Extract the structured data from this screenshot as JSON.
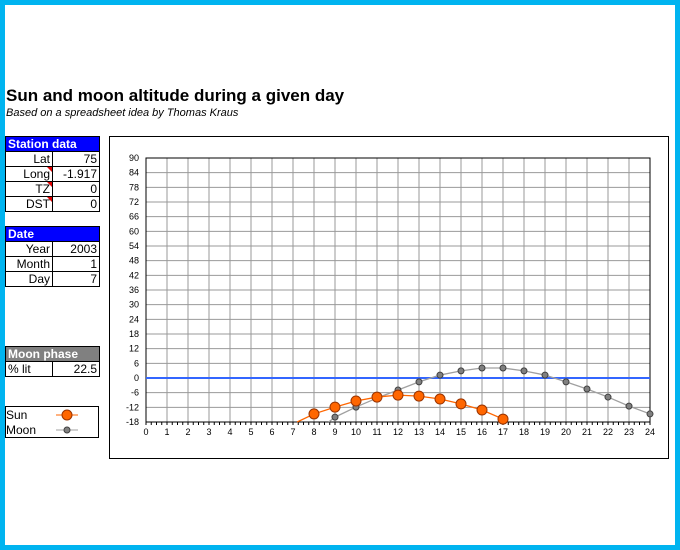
{
  "title": "Sun and moon altitude during a given day",
  "subtitle": "Based on a spreadsheet idea by Thomas Kraus",
  "station": {
    "header": "Station data",
    "rows": [
      {
        "label": "Lat",
        "value": "75"
      },
      {
        "label": "Long",
        "value": "-1.917"
      },
      {
        "label": "TZ",
        "value": "0"
      },
      {
        "label": "DST",
        "value": "0"
      }
    ]
  },
  "date": {
    "header": "Date",
    "rows": [
      {
        "label": "Year",
        "value": "2003"
      },
      {
        "label": "Month",
        "value": "1"
      },
      {
        "label": "Day",
        "value": "7"
      }
    ]
  },
  "moon_phase": {
    "header": "Moon phase",
    "label": "% lit",
    "value": "22.5"
  },
  "legend": {
    "sun": "Sun",
    "moon": "Moon"
  },
  "colors": {
    "sun": "#ff6600",
    "moon": "#808080",
    "zero_line": "#3366ff"
  },
  "chart_data": {
    "type": "line",
    "xlim": [
      0,
      24
    ],
    "ylim": [
      -18,
      90
    ],
    "x_ticks": [
      0,
      1,
      2,
      3,
      4,
      5,
      6,
      7,
      8,
      9,
      10,
      11,
      12,
      13,
      14,
      15,
      16,
      17,
      18,
      19,
      20,
      21,
      22,
      23,
      24
    ],
    "y_ticks": [
      -18,
      -12,
      -6,
      0,
      6,
      12,
      18,
      24,
      30,
      36,
      42,
      48,
      54,
      60,
      66,
      72,
      78,
      84,
      90
    ],
    "grid": true,
    "series": [
      {
        "name": "Sun",
        "x": [
          7.2,
          8,
          9,
          10,
          11,
          12,
          13,
          14,
          15,
          16,
          17,
          17.2
        ],
        "y": [
          -18,
          -14.7,
          -11.9,
          -9.4,
          -7.8,
          -7,
          -7.4,
          -8.6,
          -10.6,
          -13.1,
          -16.8,
          -18
        ],
        "markers": [
          8,
          9,
          10,
          11,
          12,
          13,
          14,
          15,
          16,
          17
        ]
      },
      {
        "name": "Moon",
        "x": [
          8.7,
          9,
          10,
          11,
          12,
          13,
          14,
          15,
          16,
          17,
          18,
          19,
          20,
          21,
          22,
          23,
          24
        ],
        "y": [
          -18,
          -16,
          -11.9,
          -8.2,
          -4.9,
          -1.6,
          1.2,
          2.9,
          4.1,
          4.1,
          2.9,
          1.2,
          -1.6,
          -4.5,
          -7.8,
          -11.5,
          -14.7
        ],
        "markers": [
          9,
          10,
          11,
          12,
          13,
          14,
          15,
          16,
          17,
          18,
          19,
          20,
          21,
          22,
          23,
          24
        ]
      }
    ]
  }
}
